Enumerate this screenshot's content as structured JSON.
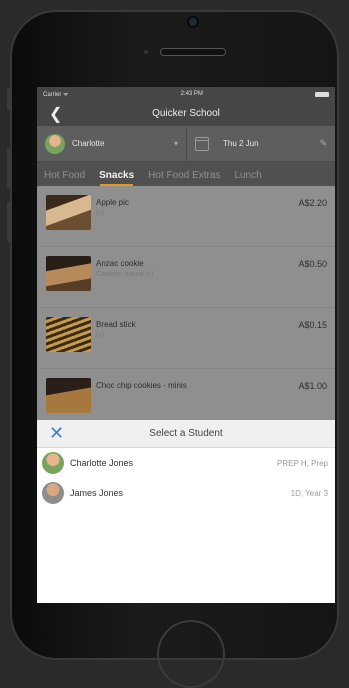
{
  "status_bar": {
    "carrier": "Carrier ᯤ",
    "time": "2:43 PM"
  },
  "nav": {
    "title": "Quicker School"
  },
  "selector": {
    "student": "Charlotte",
    "date": "Thu 2 Jun"
  },
  "tabs": [
    {
      "label": "Hot Food"
    },
    {
      "label": "Snacks"
    },
    {
      "label": "Hot Food Extras"
    },
    {
      "label": "Lunch"
    }
  ],
  "menu_items": [
    {
      "title": "Apple pic",
      "sub": "(v)",
      "price": "A$2.20"
    },
    {
      "title": "Anzac cookie",
      "sub": "Canteen baked (v)",
      "price": "A$0.50"
    },
    {
      "title": "Bread stick",
      "sub": "(v)",
      "price": "A$0.15"
    },
    {
      "title": "Choc chip cookies - minis",
      "sub": "",
      "price": "A$1.00"
    }
  ],
  "sheet": {
    "close": "✕",
    "title": "Select a Student",
    "students": [
      {
        "name": "Charlotte Jones",
        "class": "PREP H, Prep"
      },
      {
        "name": "James Jones",
        "class": "1D, Year 3"
      }
    ]
  }
}
